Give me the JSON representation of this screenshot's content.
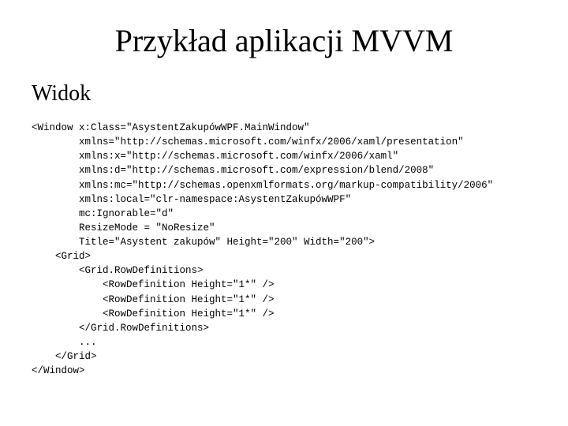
{
  "title": "Przykład aplikacji MVVM",
  "subtitle": "Widok",
  "code": {
    "l01": "<Window x:Class=\"AsystentZakupówWPF.MainWindow\"",
    "l02": "        xmlns=\"http://schemas.microsoft.com/winfx/2006/xaml/presentation\"",
    "l03": "        xmlns:x=\"http://schemas.microsoft.com/winfx/2006/xaml\"",
    "l04": "        xmlns:d=\"http://schemas.microsoft.com/expression/blend/2008\"",
    "l05": "        xmlns:mc=\"http://schemas.openxmlformats.org/markup-compatibility/2006\"",
    "l06": "        xmlns:local=\"clr-namespace:AsystentZakupówWPF\"",
    "l07": "        mc:Ignorable=\"d\"",
    "l08": "        ResizeMode = \"NoResize\"",
    "l09": "        Title=\"Asystent zakupów\" Height=\"200\" Width=\"200\">",
    "l10": "    <Grid>",
    "l11": "        <Grid.RowDefinitions>",
    "l12": "            <RowDefinition Height=\"1*\" />",
    "l13": "            <RowDefinition Height=\"1*\" />",
    "l14": "            <RowDefinition Height=\"1*\" />",
    "l15": "        </Grid.RowDefinitions>",
    "l16": "        ...",
    "l17": "    </Grid>",
    "l18": "</Window>"
  }
}
